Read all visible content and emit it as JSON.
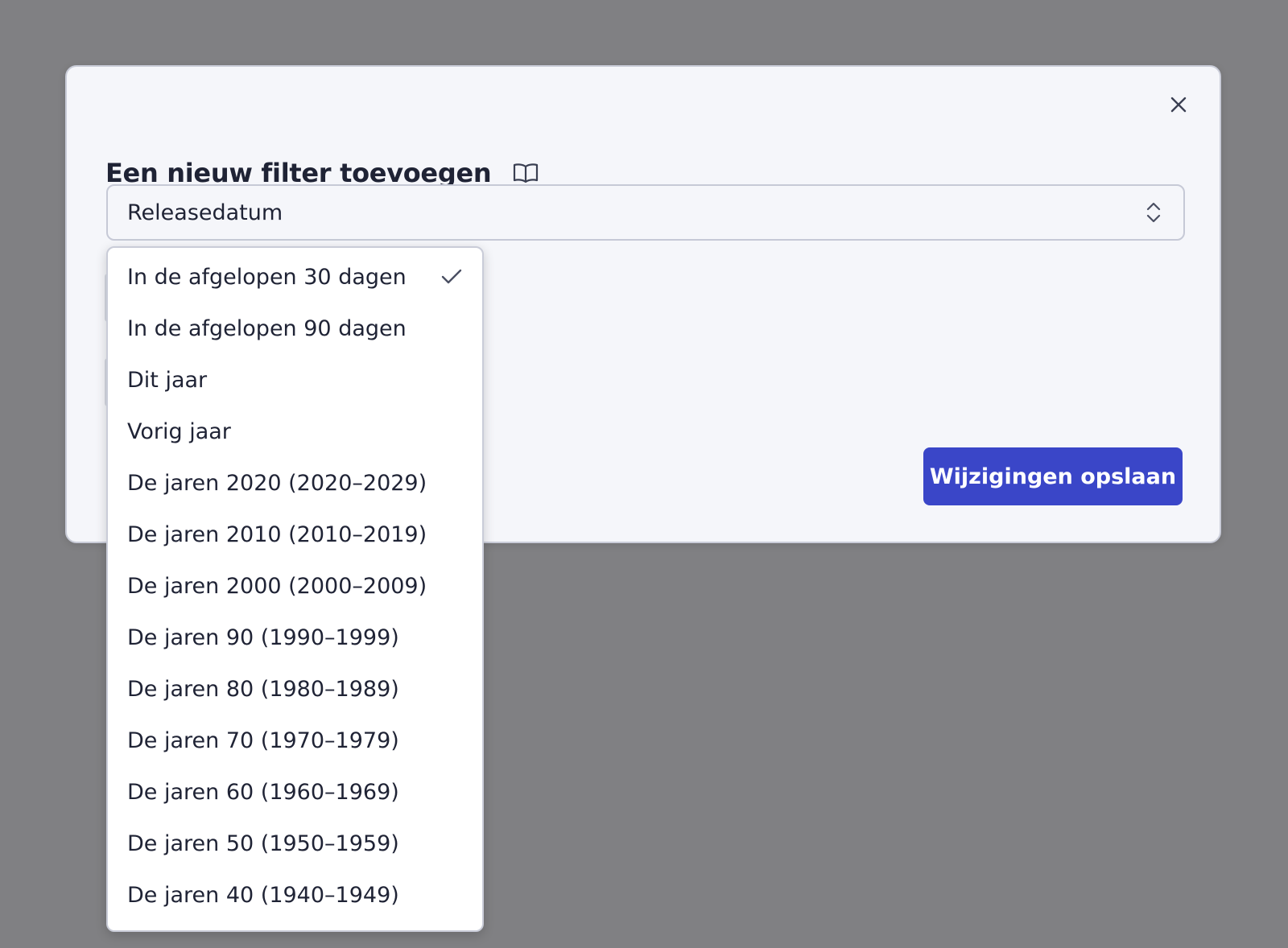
{
  "modal": {
    "title": "Een nieuw filter toevoegen",
    "close_icon": "close-icon",
    "help_icon": "book-open-icon"
  },
  "select": {
    "value": "Releasedatum",
    "icon": "chevron-up-down-icon"
  },
  "dropdown": {
    "selected_index": 0,
    "options": [
      "In de afgelopen 30 dagen",
      "In de afgelopen 90 dagen",
      "Dit jaar",
      "Vorig jaar",
      "De jaren 2020 (2020–2029)",
      "De jaren 2010 (2010–2019)",
      "De jaren 2000 (2000–2009)",
      "De jaren 90 (1990–1999)",
      "De jaren 80 (1980–1989)",
      "De jaren 70 (1970–1979)",
      "De jaren 60 (1960–1969)",
      "De jaren 50 (1950–1959)",
      "De jaren 40 (1940–1949)"
    ]
  },
  "actions": {
    "save_label": "Wijzigingen opslaan"
  },
  "colors": {
    "overlay": "#808083",
    "modal_bg": "#f5f6fa",
    "primary": "#3a46c8",
    "text": "#1f2335"
  }
}
